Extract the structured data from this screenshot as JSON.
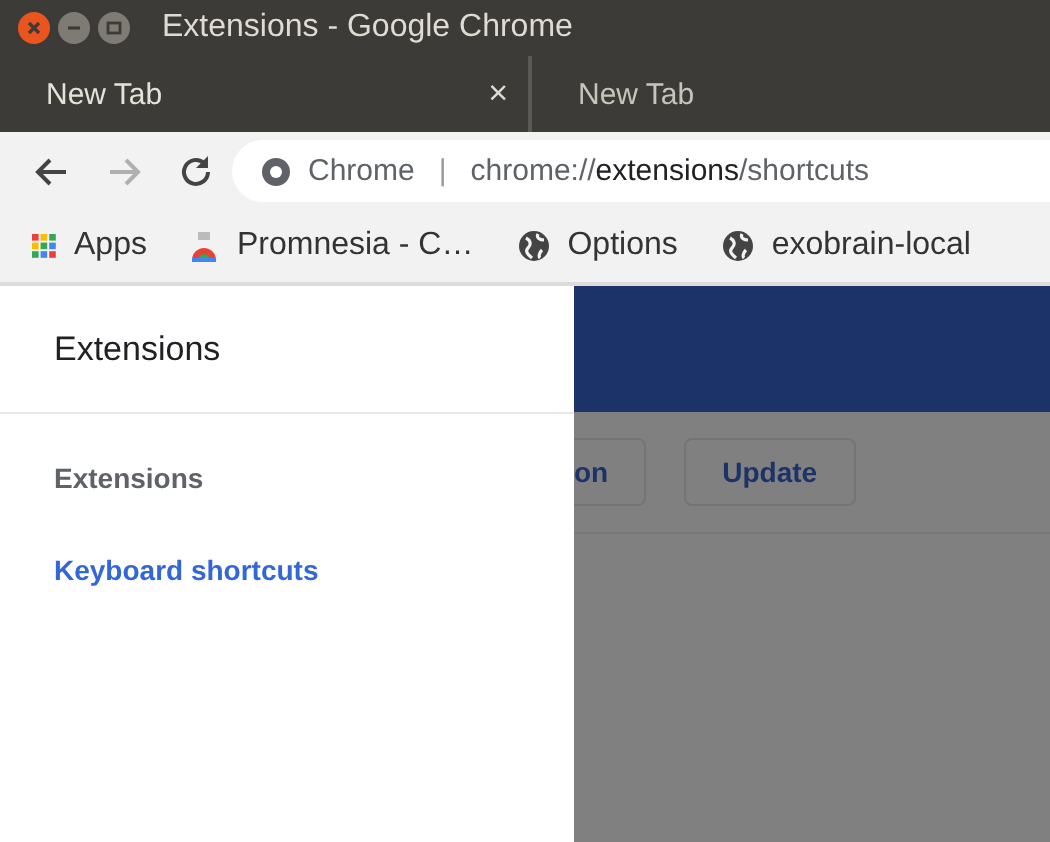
{
  "window": {
    "title": "Extensions - Google Chrome"
  },
  "tabs": [
    {
      "label": "New Tab",
      "selected": true,
      "close": "×"
    },
    {
      "label": "New Tab",
      "selected": false
    }
  ],
  "omnibox": {
    "chip": "Chrome",
    "separator": "|",
    "url": [
      {
        "text": "chrome://",
        "emphasis": false
      },
      {
        "text": "extensions",
        "emphasis": true
      },
      {
        "text": "/shortcuts",
        "emphasis": false
      }
    ]
  },
  "nav": {
    "back_disabled": false,
    "forward_disabled": true
  },
  "bookmarks": [
    {
      "label": "Apps",
      "kind": "apps"
    },
    {
      "label": "Promnesia - C…",
      "kind": "app"
    },
    {
      "label": "Options",
      "kind": "globe"
    },
    {
      "label": "exobrain-local",
      "kind": "globe"
    }
  ],
  "drawer": {
    "title": "Extensions",
    "items": [
      {
        "label": "Extensions",
        "selected": false
      },
      {
        "label": "Keyboard shortcuts",
        "selected": true
      }
    ]
  },
  "toolbar_buttons": [
    "on",
    "Update"
  ]
}
